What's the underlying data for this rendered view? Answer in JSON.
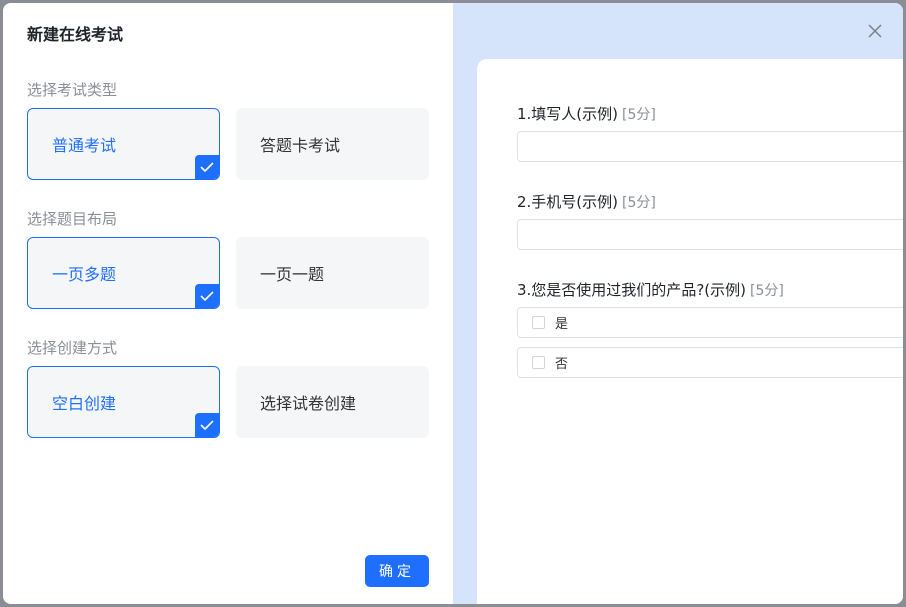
{
  "modal": {
    "title": "新建在线考试",
    "ok_label": "确定"
  },
  "sections": [
    {
      "label": "选择考试类型",
      "options": [
        {
          "label": "普通考试",
          "selected": true
        },
        {
          "label": "答题卡考试",
          "selected": false
        }
      ]
    },
    {
      "label": "选择题目布局",
      "options": [
        {
          "label": "一页多题",
          "selected": true
        },
        {
          "label": "一页一题",
          "selected": false
        }
      ]
    },
    {
      "label": "选择创建方式",
      "options": [
        {
          "label": "空白创建",
          "selected": true
        },
        {
          "label": "选择试卷创建",
          "selected": false
        }
      ]
    }
  ],
  "preview": {
    "questions": [
      {
        "title": "1.填写人(示例)",
        "score": "[5分]",
        "type": "input"
      },
      {
        "title": "2.手机号(示例)",
        "score": "[5分]",
        "type": "input"
      },
      {
        "title": "3.您是否使用过我们的产品?(示例)",
        "score": "[5分]",
        "type": "choice",
        "choices": [
          "是",
          "否"
        ]
      }
    ]
  },
  "colors": {
    "accent": "#1f6fff",
    "preview_bg": "#d6e4fb",
    "option_bg": "#f5f6f8"
  },
  "icons": {
    "close": "close-icon",
    "check": "check-icon"
  }
}
